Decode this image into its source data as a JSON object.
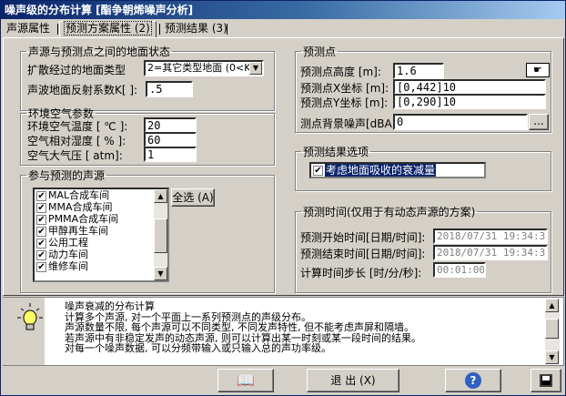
{
  "window": {
    "title": "噪声级的分布计算 [酯争朝烯噪声分析]"
  },
  "tabs": [
    "声源属性",
    "预测方案属性 (2)",
    "预测结果 (3)"
  ],
  "ground": {
    "legend": "声源与预测点之间的地面状态",
    "type_label": "扩散经过的地面类型",
    "type_value": "2=其它类型地面 (0<K",
    "reflect_label": "声波地面反射系数K[ ]:",
    "reflect_value": ".5"
  },
  "env": {
    "legend": "环境空气参数",
    "temp_label": "环境空气温度  [ ℃ ]:",
    "temp_value": "20",
    "humid_label": "空气相对湿度  [ % ]:",
    "humid_value": "60",
    "press_label": "空气大气压    [ atm]:",
    "press_value": "1"
  },
  "sources": {
    "legend": "参与预测的声源",
    "items": [
      "MAL合成车间",
      "MMA合成车间",
      "PMMA合成车间",
      "甲醇再生车间",
      "公用工程",
      "动力车间",
      "维修车间"
    ],
    "select_all": "全选 (A)"
  },
  "point": {
    "legend": "预测点",
    "height_label": "预测点高度  [m]:",
    "height_value": "1.6",
    "x_label": "预测点X坐标 [m]:",
    "x_value": "[0,442]10",
    "y_label": "预测点Y坐标 [m]:",
    "y_value": "[0,290]10",
    "bg_label": "测点背景噪声[dBA]",
    "bg_value": "0",
    "more": "..."
  },
  "options": {
    "legend": "预测结果选项",
    "item": "考虑地面吸收的衰减量"
  },
  "time": {
    "legend": "预测时间(仅用于有动态声源的方案)",
    "start_label": "预测开始时间[日期/时间]:",
    "start_value": "2018/07/31 19:34:36",
    "end_label": "预测结束时间[日期/时间]:",
    "end_value": "2018/07/31 19:34:36",
    "step_label": "计算时间步长 [时/分/秒]:",
    "step_value": "00:01:00"
  },
  "help": {
    "text": "噪声衰减的分布计算\n计算多个声源, 对一个平面上一系列预测点的声级分布。\n声源数量不限, 每个声源可以不同类型, 不同发声特性, 但不能考虑声屏和隔墙。\n若声源中有非稳定发声的动态声源, 则可以计算出某一时刻或某一段时间的结果。\n对每一个噪声数据, 可以分频带输入或只输入总的声功率级。"
  },
  "footer": {
    "exit": "退 出 (X)"
  }
}
